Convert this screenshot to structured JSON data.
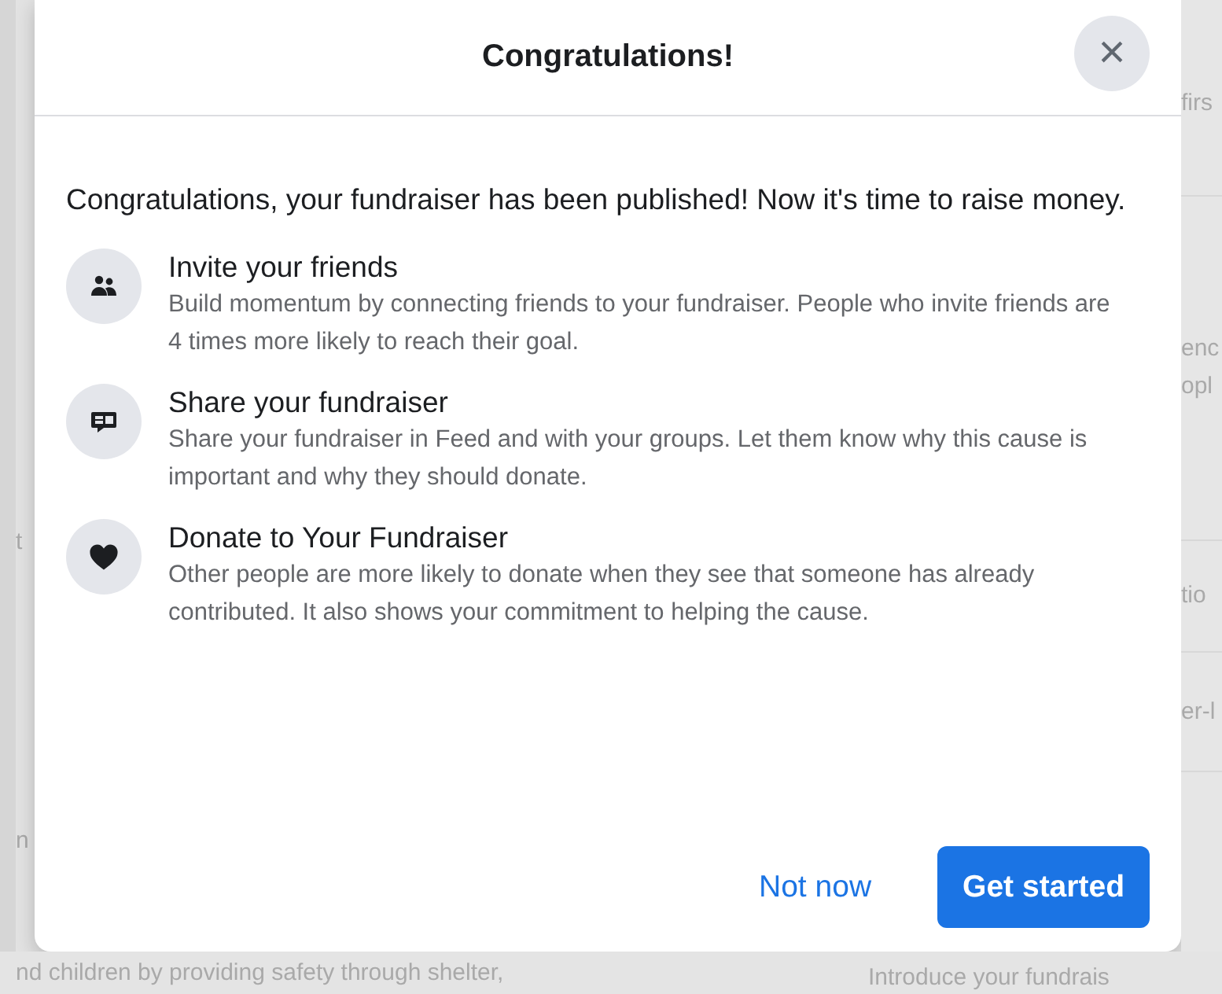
{
  "background": {
    "left_fragments": [
      "t",
      "n"
    ],
    "right_fragments": [
      "firs",
      "enc\nopl",
      "tio",
      "er-l"
    ],
    "bottom_left": "nd children by providing safety through shelter,",
    "bottom_right": "Introduce your fundrais"
  },
  "dialog": {
    "title": "Congratulations!",
    "close": "×",
    "intro": "Congratulations, your fundraiser has been published! Now it's time to raise money.",
    "steps": [
      {
        "kind": "friends",
        "title": "Invite your friends",
        "description": "Build momentum by connecting friends to your fundraiser. People who invite friends are 4 times more likely to reach their goal."
      },
      {
        "kind": "share",
        "title": "Share your fundraiser",
        "description": "Share your fundraiser in Feed and with your groups. Let them know why this cause is important and why they should donate."
      },
      {
        "kind": "donate",
        "title": "Donate to Your Fundraiser",
        "description": "Other people are more likely to donate when they see that someone has already contributed. It also shows your commitment to helping the cause."
      }
    ],
    "buttons": [
      {
        "kind": "secondary",
        "label": "Not now"
      },
      {
        "kind": "primary",
        "label": "Get started"
      }
    ]
  }
}
